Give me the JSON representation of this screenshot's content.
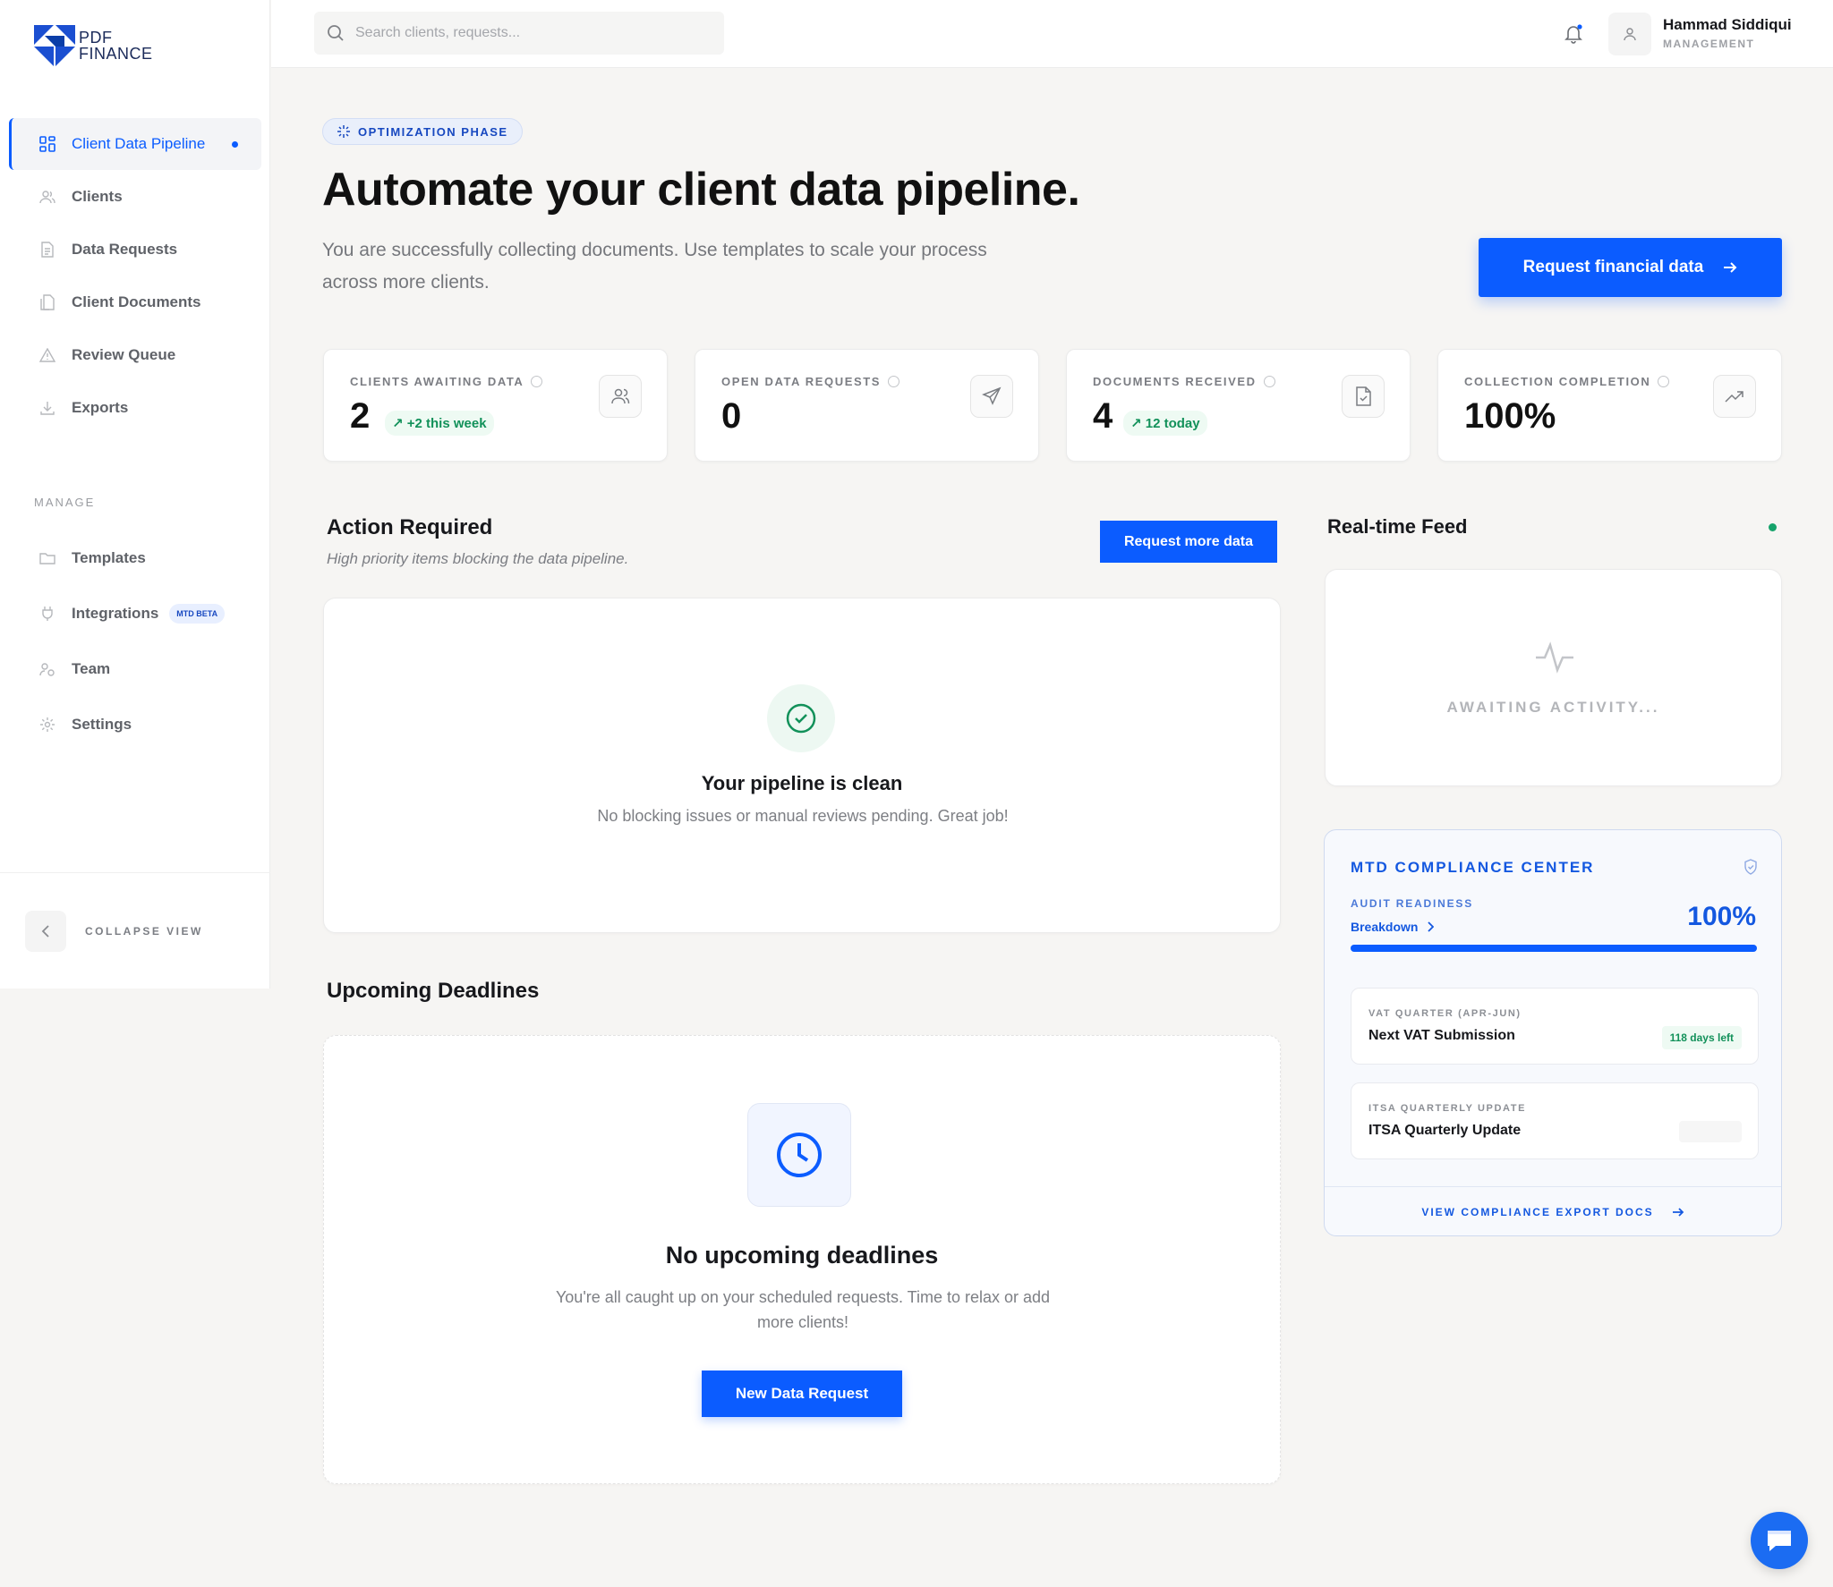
{
  "brand": {
    "line1": "PDF",
    "line2": "FINANCE",
    "color": "#1b4fd1"
  },
  "nav": {
    "items": [
      {
        "label": "Client Data Pipeline",
        "icon": "grid-icon",
        "active": true
      },
      {
        "label": "Clients",
        "icon": "users-icon"
      },
      {
        "label": "Data Requests",
        "icon": "file-icon"
      },
      {
        "label": "Client Documents",
        "icon": "documents-icon"
      },
      {
        "label": "Review Queue",
        "icon": "warning-icon"
      },
      {
        "label": "Exports",
        "icon": "download-icon"
      }
    ],
    "manage_label": "MANAGE",
    "manage_items": [
      {
        "label": "Templates",
        "icon": "folder-icon"
      },
      {
        "label": "Integrations",
        "icon": "plug-icon",
        "badge": "MTD BETA"
      },
      {
        "label": "Team",
        "icon": "team-icon"
      },
      {
        "label": "Settings",
        "icon": "gear-icon"
      }
    ],
    "collapse_label": "COLLAPSE VIEW"
  },
  "topbar": {
    "search_placeholder": "Search clients, requests...",
    "user_name": "Hammad Siddiqui",
    "user_role": "MANAGEMENT"
  },
  "hero": {
    "phase": "OPTIMIZATION PHASE",
    "title": "Automate your client data pipeline.",
    "subtitle": "You are successfully collecting documents. Use templates to scale your process across more clients.",
    "cta": "Request financial data"
  },
  "stats": [
    {
      "label": "CLIENTS AWAITING DATA",
      "value": "2",
      "delta": "+2 this week",
      "icon": "users-icon"
    },
    {
      "label": "OPEN DATA REQUESTS",
      "value": "0",
      "delta": "",
      "icon": "send-icon"
    },
    {
      "label": "DOCUMENTS RECEIVED",
      "value": "4",
      "delta": "12 today",
      "icon": "document-check-icon"
    },
    {
      "label": "COLLECTION COMPLETION",
      "value": "100%",
      "delta": "",
      "icon": "trend-up-icon"
    }
  ],
  "action": {
    "title": "Action Required",
    "subtitle": "High priority items blocking the data pipeline.",
    "button": "Request more data",
    "empty_title": "Your pipeline is clean",
    "empty_sub": "No blocking issues or manual reviews pending. Great job!"
  },
  "feed": {
    "title": "Real-time Feed",
    "empty": "AWAITING ACTIVITY..."
  },
  "deadlines": {
    "title": "Upcoming Deadlines",
    "empty_title": "No upcoming deadlines",
    "empty_sub": "You're all caught up on your scheduled requests. Time to relax or add more clients!",
    "button": "New Data Request"
  },
  "mtd": {
    "title": "MTD COMPLIANCE CENTER",
    "audit_label": "AUDIT READINESS",
    "breakdown": "Breakdown",
    "audit_pct": "100%",
    "audit_fraction": 1.0,
    "items": [
      {
        "label": "VAT QUARTER (APR-JUN)",
        "title": "Next VAT Submission",
        "badge": "118 days left"
      },
      {
        "label": "ITSA QUARTERLY UPDATE",
        "title": "ITSA Quarterly Update",
        "badge": ""
      }
    ],
    "footer": "VIEW COMPLIANCE EXPORT DOCS"
  },
  "colors": {
    "accent": "#0b5cff",
    "success": "#12915a"
  }
}
